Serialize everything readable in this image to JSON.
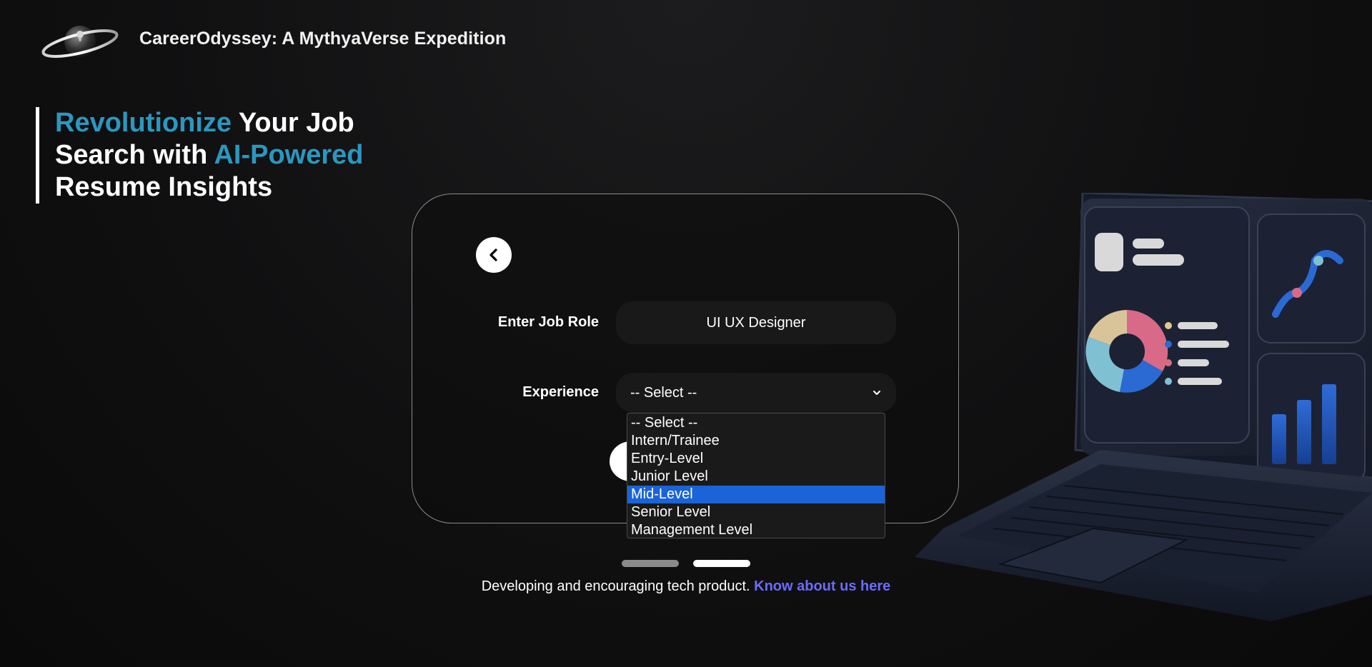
{
  "header": {
    "brand_title": "CareerOdyssey: A MythyaVerse Expedition",
    "logo_icon": "planet-logo-icon"
  },
  "hero": {
    "line1_accent": "Revolutionize",
    "line1_rest": " Your Job",
    "line2_plain": "Search with ",
    "line2_accent": "AI-Powered",
    "line3_plain": "Resume Insights",
    "accent_color": "#2b97c0"
  },
  "form": {
    "back_icon": "chevron-left-icon",
    "job_role_label": "Enter Job Role",
    "job_role_value": "UI UX Designer",
    "experience_label": "Experience",
    "experience_selected": "-- Select --",
    "experience_options": [
      "-- Select --",
      "Intern/Trainee",
      "Entry-Level",
      "Junior Level",
      "Mid-Level",
      "Senior Level",
      "Management Level"
    ],
    "highlighted_option": "Mid-Level",
    "highlight_color": "#1a63d8"
  },
  "pager": {
    "count": 2,
    "active_index": 1
  },
  "footer": {
    "text": "Developing and encouraging tech product. ",
    "link_text": "Know about us here",
    "link_color": "#6b6bff"
  }
}
